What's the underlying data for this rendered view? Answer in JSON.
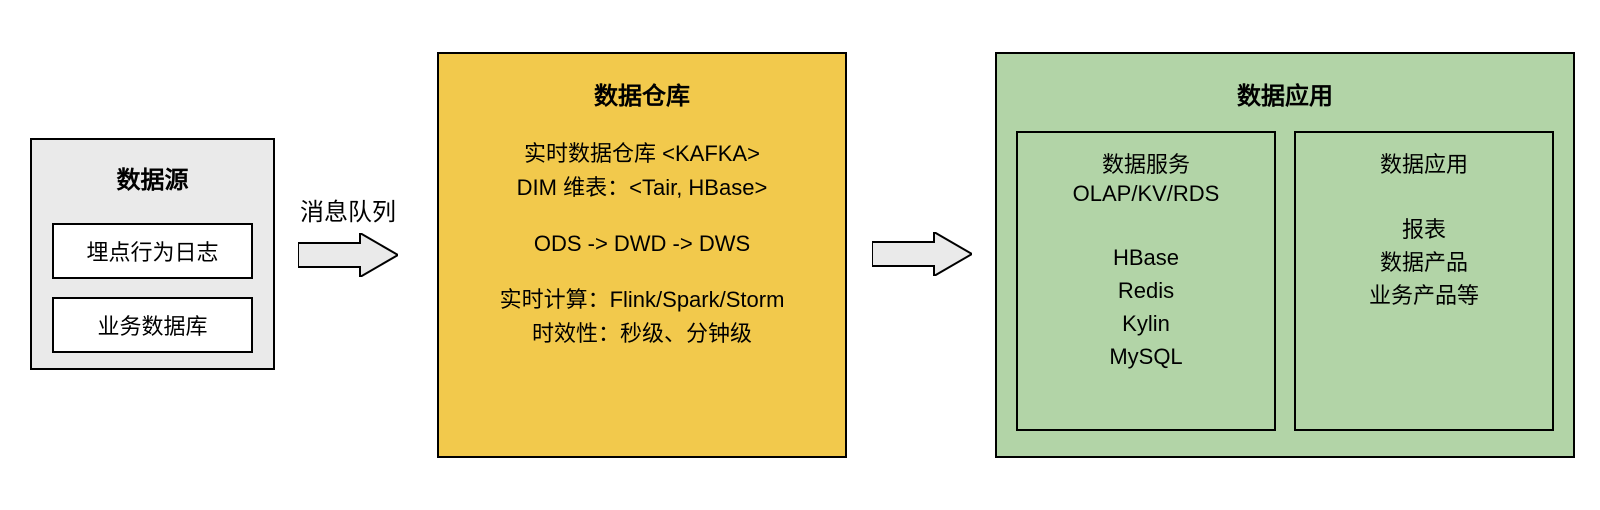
{
  "dataSource": {
    "title": "数据源",
    "items": [
      "埋点行为日志",
      "业务数据库"
    ]
  },
  "arrow1": {
    "label": "消息队列"
  },
  "warehouse": {
    "title": "数据仓库",
    "line1": "实时数据仓库 <KAFKA>",
    "line2": "DIM 维表：<Tair, HBase>",
    "line3": "ODS -> DWD -> DWS",
    "line4": "实时计算：Flink/Spark/Storm",
    "line5": "时效性：秒级、分钟级"
  },
  "arrow2": {
    "label": ""
  },
  "app": {
    "title": "数据应用",
    "col1": {
      "title": "数据服务",
      "sub": "OLAP/KV/RDS",
      "l1": "HBase",
      "l2": "Redis",
      "l3": "Kylin",
      "l4": "MySQL"
    },
    "col2": {
      "title": "数据应用",
      "l1": "报表",
      "l2": "数据产品",
      "l3": "业务产品等"
    }
  },
  "colors": {
    "source_bg": "#eaeaea",
    "warehouse_bg": "#f2c94c",
    "app_bg": "#b2d4a7"
  }
}
